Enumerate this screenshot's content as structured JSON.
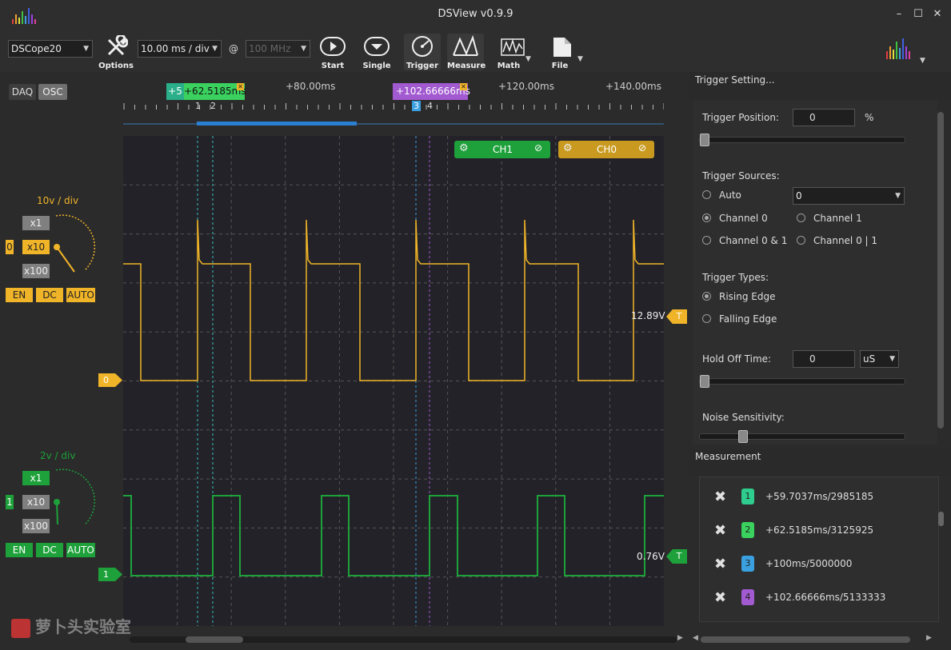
{
  "window": {
    "title": "DSView v0.9.9",
    "min": "–",
    "max": "☐",
    "close": "✕"
  },
  "toolbar": {
    "device": "DSCope20",
    "timebase": "10.00 ms / div",
    "at": "@",
    "samplerate": "100 MHz",
    "options": "Options",
    "start": "Start",
    "single": "Single",
    "trigger": "Trigger",
    "measure": "Measure",
    "math": "Math",
    "file": "File"
  },
  "modes": {
    "daq": "DAQ",
    "osc": "OSC"
  },
  "channels": [
    {
      "name": "CH0",
      "index": "0",
      "vdiv": "10v / div",
      "scales": [
        "x1",
        "x10",
        "x100"
      ],
      "active_scale": "x10",
      "coupling": [
        "EN",
        "DC",
        "AUTO"
      ],
      "trig_level": "12.89V",
      "trig_tag": "T",
      "color": "#f0b429"
    },
    {
      "name": "CH1",
      "index": "1",
      "vdiv": "2v / div",
      "scales": [
        "x1",
        "x10",
        "x100"
      ],
      "active_scale": "x1",
      "coupling": [
        "EN",
        "DC",
        "AUTO"
      ],
      "trig_level": "0.76V",
      "trig_tag": "T",
      "color": "#1ea13a"
    }
  ],
  "ruler": {
    "ticks": [
      "+80.00ms",
      "+120.00ms",
      "+140.00ms"
    ],
    "cursor_a_label": "+62.5185ms",
    "cursor_a_prefix": "+5",
    "cursor_b_label": "+102.66666ms",
    "cursor_nums": [
      "1",
      "2",
      "3",
      "4"
    ]
  },
  "trigger": {
    "title": "Trigger Setting...",
    "position_label": "Trigger Position:",
    "position_value": "0",
    "position_unit": "%",
    "sources_label": "Trigger Sources:",
    "src_auto": "Auto",
    "src_auto_value": "0",
    "src_ch0": "Channel 0",
    "src_ch1": "Channel 1",
    "src_and": "Channel 0 & 1",
    "src_or": "Channel 0 | 1",
    "types_label": "Trigger Types:",
    "type_rising": "Rising Edge",
    "type_falling": "Falling Edge",
    "holdoff_label": "Hold Off Time:",
    "holdoff_value": "0",
    "holdoff_unit": "uS",
    "noise_label": "Noise Sensitivity:"
  },
  "measurement": {
    "title": "Measurement",
    "rows": [
      {
        "id": "1",
        "text": "+59.7037ms/2985185",
        "color": "#2ecc8f"
      },
      {
        "id": "2",
        "text": "+62.5185ms/3125925",
        "color": "#3ad15e"
      },
      {
        "id": "3",
        "text": "+100ms/5000000",
        "color": "#3aa0e0"
      },
      {
        "id": "4",
        "text": "+102.66666ms/5133333",
        "color": "#a25ad0"
      }
    ]
  },
  "watermark": "萝卜头实验室"
}
